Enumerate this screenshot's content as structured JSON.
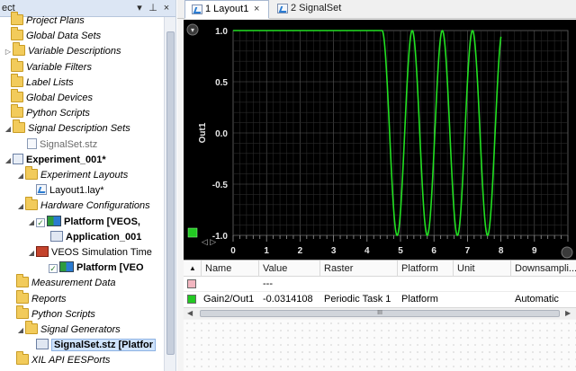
{
  "project_pane": {
    "title": "ect",
    "pin_label": "▼ ┼ ×"
  },
  "tree": [
    {
      "label": "Project Plans",
      "icon": "folder",
      "style": "italic"
    },
    {
      "label": "Global Data Sets",
      "icon": "folder",
      "style": "italic"
    },
    {
      "label": "Variable Descriptions",
      "icon": "folder",
      "style": "italic",
      "twisty": "▷"
    },
    {
      "label": "Variable Filters",
      "icon": "folder",
      "style": "italic"
    },
    {
      "label": "Label Lists",
      "icon": "folder",
      "style": "italic"
    },
    {
      "label": "Global Devices",
      "icon": "folder",
      "style": "italic"
    },
    {
      "label": "Python Scripts",
      "icon": "folder",
      "style": "italic"
    },
    {
      "label": "Signal Description Sets",
      "icon": "folder",
      "style": "italic",
      "twisty": "◢"
    },
    {
      "label": "SignalSet.stz",
      "icon": "file",
      "style": "gray"
    },
    {
      "label": "Experiment_001*",
      "icon": "experiment",
      "style": "bold",
      "twisty": "◢"
    },
    {
      "label": "Experiment Layouts",
      "icon": "folder",
      "style": "italic",
      "twisty": "◢"
    },
    {
      "label": "Layout1.lay*",
      "icon": "layout",
      "style": "normal"
    },
    {
      "label": "Hardware Configurations",
      "icon": "folder",
      "style": "italic",
      "twisty": "◢"
    },
    {
      "label": "Platform [VEOS,",
      "icon": "platform",
      "style": "bold",
      "twisty": "◢"
    },
    {
      "label": "Application_001",
      "icon": "application",
      "style": "bold"
    },
    {
      "label": "VEOS Simulation Time",
      "icon": "simulation",
      "style": "normal",
      "twisty": "◢"
    },
    {
      "label": "Platform [VEO",
      "icon": "platform",
      "style": "bold"
    },
    {
      "label": "Measurement Data",
      "icon": "folder",
      "style": "italic"
    },
    {
      "label": "Reports",
      "icon": "folder",
      "style": "italic"
    },
    {
      "label": "Python Scripts",
      "icon": "folder",
      "style": "italic"
    },
    {
      "label": "Signal Generators",
      "icon": "folder",
      "style": "italic",
      "twisty": "◢"
    },
    {
      "label": "SignalSet.stz [Platfor",
      "icon": "signal-generator",
      "style": "bold",
      "selected": true
    },
    {
      "label": "XIL API EESPorts",
      "icon": "folder",
      "style": "italic"
    }
  ],
  "tabs": [
    {
      "label": "1 Layout1",
      "close": "×",
      "active": true
    },
    {
      "label": "2 SignalSet",
      "active": false
    }
  ],
  "chart_data": {
    "type": "line",
    "title": "",
    "xlabel": "",
    "ylabel": "Out1",
    "xlim": [
      0,
      10
    ],
    "ylim": [
      -1.0,
      1.0
    ],
    "x_ticks": [
      "0",
      "1",
      "2",
      "3",
      "4",
      "5",
      "6",
      "7",
      "8",
      "9"
    ],
    "y_ticks": [
      "1.0",
      "0.5",
      "0.0",
      "-0.5",
      "-1.0"
    ],
    "grid": true,
    "background": "#000000",
    "series": [
      {
        "color": "#22e022",
        "segments": [
          {
            "shape": "constant",
            "x_from": 0,
            "x_to": 4.45,
            "y": 1.0
          },
          {
            "shape": "sine",
            "x_from": 4.45,
            "x_to": 8.0,
            "amplitude": 1.0,
            "period": 0.9
          }
        ]
      }
    ]
  },
  "signal_table": {
    "columns": [
      "Name",
      "Value",
      "Raster",
      "Platform",
      "Unit",
      "Downsampli..."
    ],
    "rows": [
      {
        "color": "#f2b6c0",
        "name": "",
        "value": "---",
        "raster": "",
        "platform": "",
        "unit": "",
        "downsampling": ""
      },
      {
        "color": "#22c922",
        "name": "Gain2/Out1",
        "value": "-0.0314108",
        "raster": "Periodic Task 1",
        "platform": "Platform",
        "unit": "",
        "downsampling": "Automatic"
      }
    ],
    "scroll_thumb": "III"
  }
}
